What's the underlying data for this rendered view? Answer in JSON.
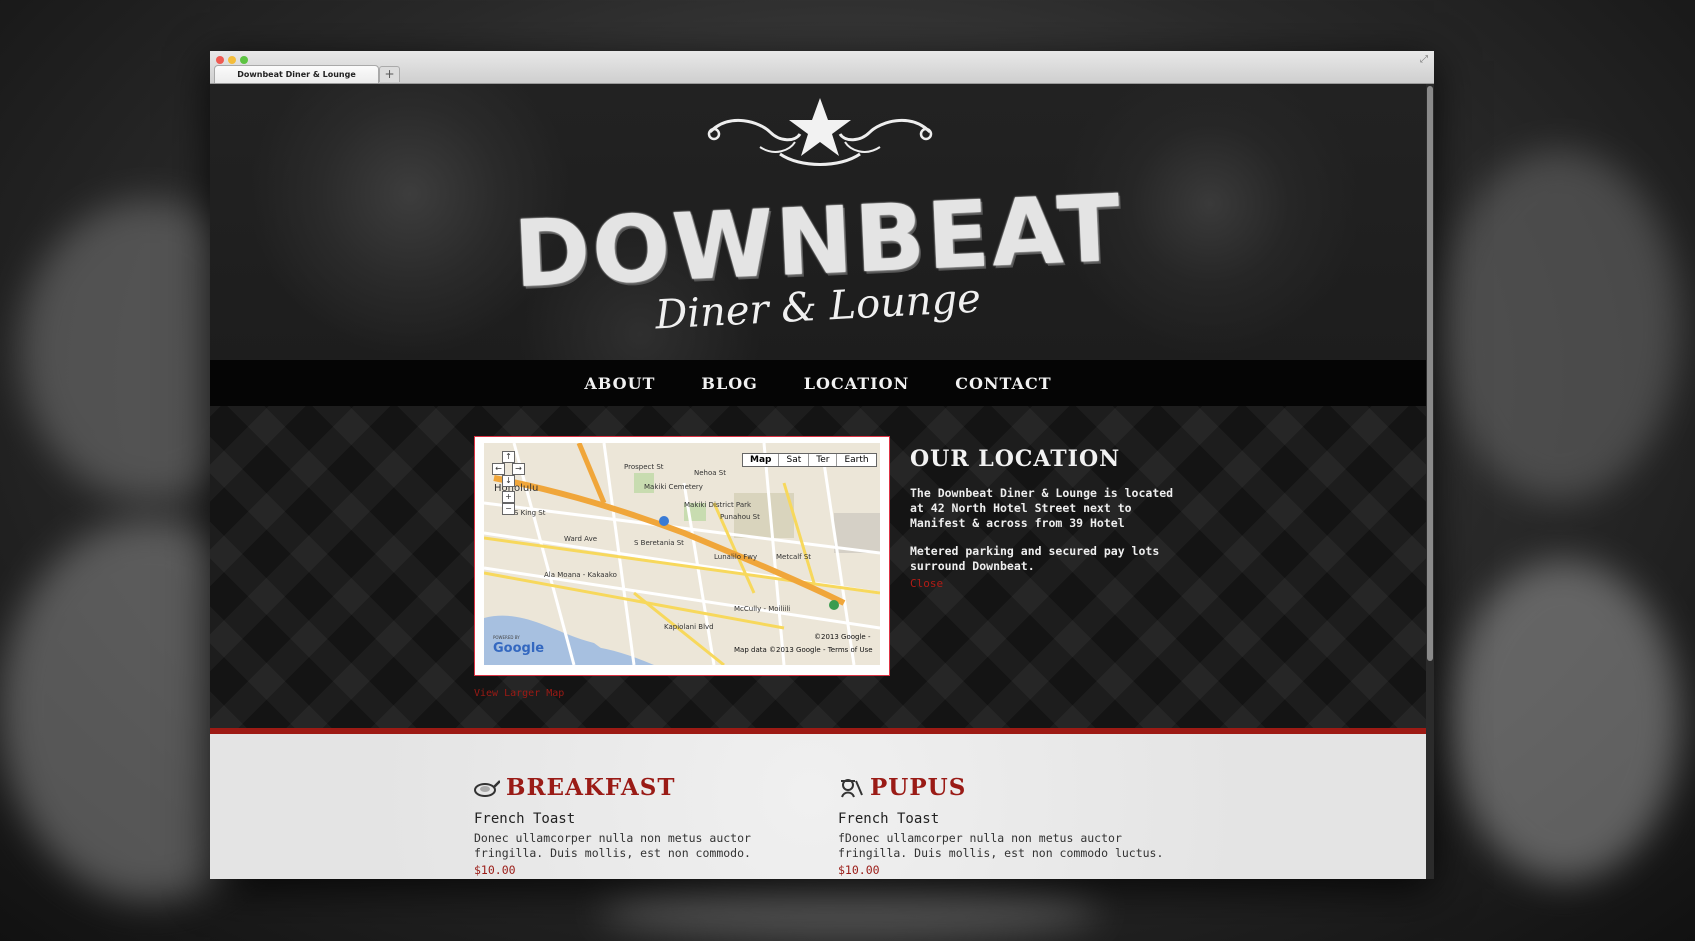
{
  "browser": {
    "tab_title": "Downbeat Diner & Lounge",
    "new_tab_label": "+"
  },
  "hero": {
    "logo_main": "DOWNBEAT",
    "logo_sub": "Diner & Lounge"
  },
  "nav": {
    "items": [
      {
        "label": "ABOUT"
      },
      {
        "label": "BLOG"
      },
      {
        "label": "LOCATION"
      },
      {
        "label": "CONTACT"
      }
    ]
  },
  "map": {
    "types": [
      "Map",
      "Sat",
      "Ter",
      "Earth"
    ],
    "active_type": "Map",
    "labels": [
      "Honolulu",
      "Makiki Cemetery",
      "Makiki District Park",
      "Ala Moana - Kakaako",
      "McCully - Moiliili",
      "S King St",
      "S Beretania St",
      "Lunalilo Fwy",
      "Kapiolani Blvd",
      "Metcalf St",
      "Punahou St",
      "Ward Ave",
      "Prospect St",
      "Nehoa St"
    ],
    "copyright": "©2013 Google -",
    "data_credit": "Map data ©2013 Google - Terms of Use",
    "powered_by": "POWERED BY",
    "google": "Google",
    "view_larger": "View Larger Map"
  },
  "location": {
    "title": "OUR LOCATION",
    "paragraph_1": "The Downbeat Diner & Lounge is located at 42 North Hotel Street next to Manifest & across from 39 Hotel",
    "paragraph_2": "Metered parking and secured pay lots surround Downbeat.",
    "close": "Close"
  },
  "menu": {
    "sections": [
      {
        "heading": "BREAKFAST",
        "icon": "skillet-icon",
        "item_name": "French Toast",
        "item_desc": "Donec ullamcorper nulla non metus auctor fringilla. Duis mollis, est non commodo.",
        "item_price": "$10.00"
      },
      {
        "heading": "PUPUS",
        "icon": "chef-icon",
        "item_name": "French Toast",
        "item_desc": "fDonec ullamcorper nulla non metus auctor fringilla. Duis mollis, est non commodo luctus.",
        "item_price": "$10.00"
      }
    ]
  },
  "colors": {
    "accent_red": "#9d1a14",
    "nav_background": "#050505",
    "menu_background": "#e6e6e6"
  }
}
